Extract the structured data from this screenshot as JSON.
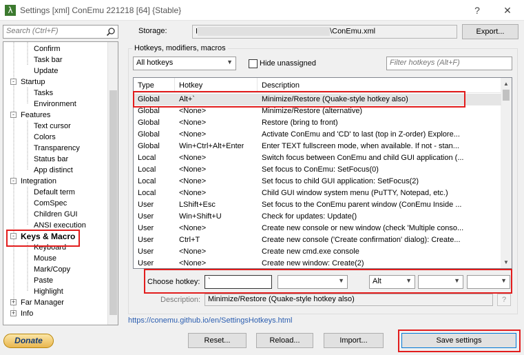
{
  "window": {
    "title": "Settings [xml] ConEmu 221218 [64] {Stable}",
    "help_label": "?",
    "close_label": "✕"
  },
  "sidebar": {
    "search_placeholder": "Search (Ctrl+F)",
    "tree": [
      {
        "label": "Confirm",
        "level": 2
      },
      {
        "label": "Task bar",
        "level": 2
      },
      {
        "label": "Update",
        "level": 2
      },
      {
        "label": "Startup",
        "level": 1,
        "expander": "-"
      },
      {
        "label": "Tasks",
        "level": 2
      },
      {
        "label": "Environment",
        "level": 2
      },
      {
        "label": "Features",
        "level": 1,
        "expander": "-"
      },
      {
        "label": "Text cursor",
        "level": 2
      },
      {
        "label": "Colors",
        "level": 2
      },
      {
        "label": "Transparency",
        "level": 2
      },
      {
        "label": "Status bar",
        "level": 2
      },
      {
        "label": "App distinct",
        "level": 2
      },
      {
        "label": "Integration",
        "level": 1,
        "expander": "-"
      },
      {
        "label": "Default term",
        "level": 2
      },
      {
        "label": "ComSpec",
        "level": 2
      },
      {
        "label": "Children GUI",
        "level": 2
      },
      {
        "label": "ANSI execution",
        "level": 2
      },
      {
        "label": "Keys & Macro",
        "level": 1,
        "expander": "-",
        "selected": true
      },
      {
        "label": "Keyboard",
        "level": 2
      },
      {
        "label": "Mouse",
        "level": 2
      },
      {
        "label": "Mark/Copy",
        "level": 2
      },
      {
        "label": "Paste",
        "level": 2
      },
      {
        "label": "Highlight",
        "level": 2
      },
      {
        "label": "Far Manager",
        "level": 1,
        "expander": "+"
      },
      {
        "label": "Info",
        "level": 1,
        "expander": "+"
      }
    ]
  },
  "storage": {
    "label": "Storage:",
    "value_prefix": "I",
    "value_suffix": "\\ConEmu.xml",
    "export_label": "Export..."
  },
  "hotkeys": {
    "group_title": "Hotkeys, modifiers, macros",
    "filter_select": "All hotkeys",
    "hide_unassigned_label": "Hide unassigned",
    "filter_placeholder": "Filter hotkeys (Alt+F)",
    "columns": [
      "Type",
      "Hotkey",
      "Description"
    ],
    "rows": [
      [
        "Global",
        "Alt+`",
        "Minimize/Restore (Quake-style hotkey also)"
      ],
      [
        "Global",
        "<None>",
        "Minimize/Restore (alternative)"
      ],
      [
        "Global",
        "<None>",
        "Restore (bring to front)"
      ],
      [
        "Global",
        "<None>",
        "Activate ConEmu and 'CD' to last (top in Z-order) Explore..."
      ],
      [
        "Global",
        "Win+Ctrl+Alt+Enter",
        "Enter TEXT fullscreen mode, when available. If not - stan..."
      ],
      [
        "Local",
        "<None>",
        "Switch focus between ConEmu and child GUI application (..."
      ],
      [
        "Local",
        "<None>",
        "Set focus to ConEmu: SetFocus(0)"
      ],
      [
        "Local",
        "<None>",
        "Set focus to child GUI application: SetFocus(2)"
      ],
      [
        "Local",
        "<None>",
        "Child GUI window system menu (PuTTY, Notepad, etc.)"
      ],
      [
        "User",
        "LShift+Esc",
        "Set focus to the ConEmu parent window (ConEmu Inside ..."
      ],
      [
        "User",
        "Win+Shift+U",
        "Check for updates: Update()"
      ],
      [
        "User",
        "<None>",
        "Create new console or new window (check 'Multiple conso..."
      ],
      [
        "User",
        "Ctrl+T",
        "Create new console ('Create confirmation' dialog): Create..."
      ],
      [
        "User",
        "<None>",
        "Create new cmd.exe console"
      ],
      [
        "User",
        "<None>",
        "Create new window: Create(2)"
      ]
    ],
    "choose_label": "Choose hotkey:",
    "choose_value": "`",
    "modifier_1": "Alt",
    "description_label": "Description:",
    "description_value": "Minimize/Restore (Quake-style hotkey also)",
    "q_label": "?"
  },
  "footer": {
    "link": "https://conemu.github.io/en/SettingsHotkeys.html",
    "donate": "Donate",
    "reset": "Reset...",
    "reload": "Reload...",
    "import": "Import...",
    "save": "Save settings"
  },
  "colors": {
    "highlight_box": "#e21c1c",
    "link": "#2a5db0"
  }
}
